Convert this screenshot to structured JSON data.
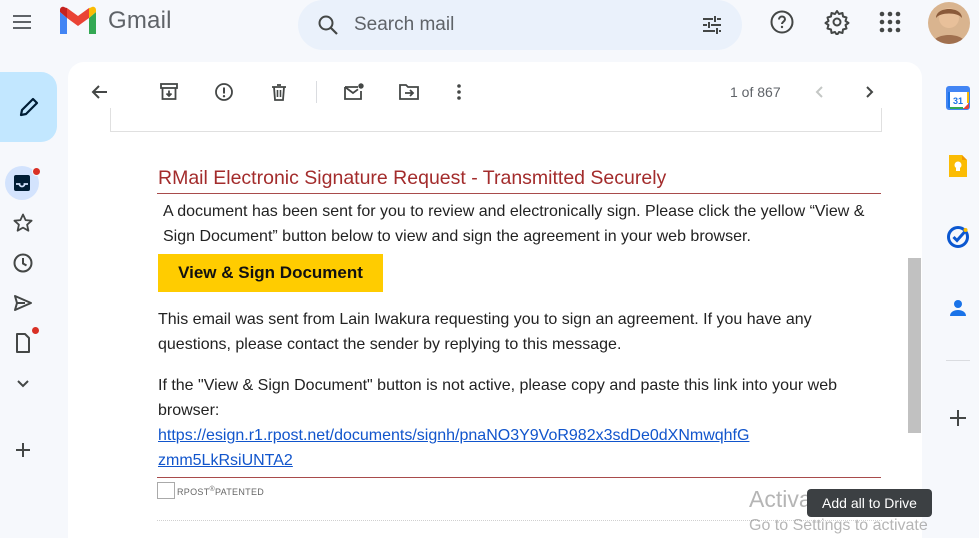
{
  "app": {
    "name": "Gmail"
  },
  "search": {
    "placeholder": "Search mail"
  },
  "toolbar": {
    "pager_text": "1 of 867"
  },
  "email": {
    "title": "RMail Electronic Signature Request - Transmitted Securely",
    "intro": "A document has been sent for you to review and electronically sign. Please click the yellow “View & Sign Document” button below to view and sign the agreement in your web browser.",
    "button_label": "View & Sign Document",
    "sender_note": "This email was sent from Lain Iwakura requesting you to sign an agreement. If you have any questions, please contact the sender by replying to this message.",
    "link_note": "If the \"View & Sign Document\" button is not active, please copy and paste this link into your web browser:",
    "link_line1": "https://esign.r1.rpost.net/documents/signh/pnaNO3Y9VoR982x3sdDe0dXNmwqhfG",
    "link_line2": "zmm5LkRsiUNTA2",
    "patent_brand": "RPOST",
    "patent_mark": "®",
    "patent_word": "PATENTED"
  },
  "tooltip": {
    "text": "Add all to Drive"
  },
  "watermark": {
    "line1": "Activate Windows",
    "line2": "Go to Settings to activate"
  },
  "colors": {
    "accent": "#0b57d0",
    "title_red": "#a32c2c",
    "button_yellow": "#ffcc00"
  },
  "right_rail": {
    "calendar_day": "31"
  },
  "icons": [
    "menu-icon",
    "gmail-logo",
    "search-icon",
    "search-options-icon",
    "help-icon",
    "settings-icon",
    "apps-icon",
    "compose-icon",
    "inbox-icon",
    "star-icon",
    "clock-icon",
    "send-icon",
    "drafts-icon",
    "chevron-down-icon",
    "plus-icon",
    "back-arrow-icon",
    "archive-icon",
    "report-spam-icon",
    "delete-icon",
    "mark-unread-icon",
    "move-to-icon",
    "more-vert-icon",
    "chevron-left-icon",
    "chevron-right-icon",
    "calendar-icon",
    "keep-icon",
    "tasks-icon",
    "contacts-icon"
  ]
}
